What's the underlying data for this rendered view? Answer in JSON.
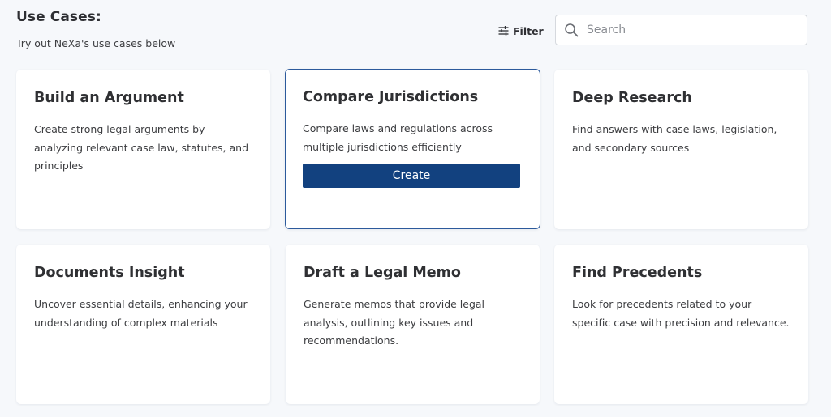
{
  "header": {
    "title": "Use Cases:",
    "subtitle": "Try out NeXa's use cases below"
  },
  "filter": {
    "label": "Filter",
    "icon": "sliders-icon"
  },
  "search": {
    "placeholder": "Search",
    "value": "",
    "icon": "search-icon"
  },
  "cards": [
    {
      "title": "Build an Argument",
      "description": "Create strong legal arguments by analyzing relevant case law, statutes, and principles"
    },
    {
      "title": "Compare Jurisdictions",
      "description": "Compare laws and regulations across multiple jurisdictions efficiently",
      "button_label": "Create",
      "highlighted": true
    },
    {
      "title": "Deep Research",
      "description": "Find answers with case laws, legislation, and secondary sources"
    },
    {
      "title": "Documents Insight",
      "description": "Uncover essential details, enhancing your understanding of complex materials"
    },
    {
      "title": "Draft a Legal Memo",
      "description": "Generate memos that provide legal analysis, outlining key issues and recommendations."
    },
    {
      "title": "Find Precedents",
      "description": "Look for precedents related to your specific case with precision and relevance."
    }
  ],
  "colors": {
    "accent": "#12417f",
    "active_border": "#2c5a9c",
    "background": "#f6f8fb"
  }
}
